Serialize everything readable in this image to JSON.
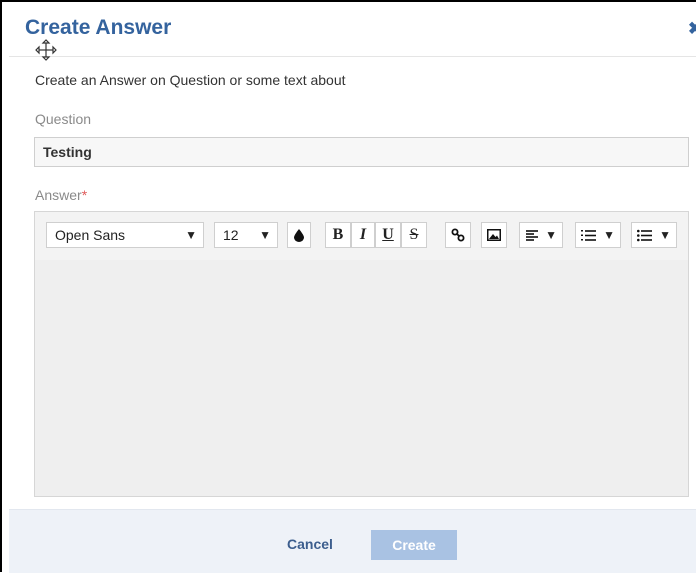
{
  "dialog": {
    "title": "Create Answer",
    "close_symbol": "✖",
    "description": "Create an Answer on Question or some text about"
  },
  "question": {
    "label": "Question",
    "value": "Testing"
  },
  "answer": {
    "label": "Answer",
    "required_marker": "*"
  },
  "toolbar": {
    "font_family": "Open Sans",
    "font_size": "12",
    "bold": "B",
    "italic": "I",
    "underline": "U",
    "strike": "S",
    "caret": "▼",
    "icons": [
      "move-icon",
      "text-color-icon",
      "link-icon",
      "image-icon",
      "align-icon",
      "ordered-list-icon",
      "bullet-list-icon"
    ]
  },
  "footer": {
    "cancel_label": "Cancel",
    "create_label": "Create"
  },
  "colors": {
    "accent": "#34639e",
    "create_button": "#a9c2e3",
    "footer_bg": "#eef2f8",
    "required": "#e05a5a"
  }
}
